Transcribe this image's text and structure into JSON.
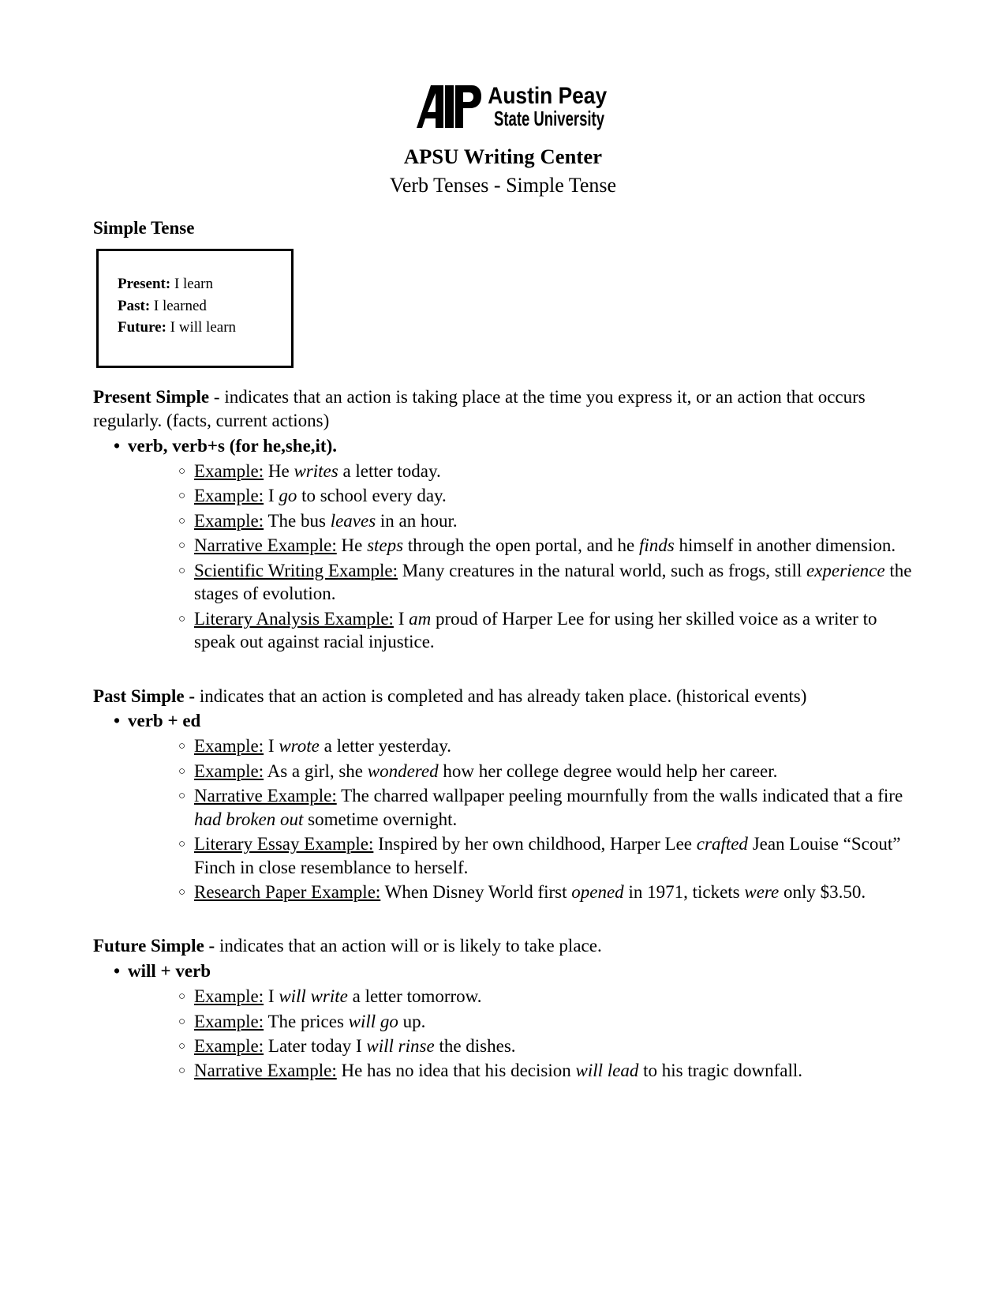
{
  "header": {
    "logo_alt": "Austin Peay State University",
    "logo_line1": "Austin Peay",
    "logo_line2": "State University",
    "org_title": "APSU Writing Center",
    "doc_subtitle": "Verb Tenses - Simple Tense"
  },
  "section_heading": "Simple Tense",
  "tense_box": {
    "rows": [
      {
        "label": "Present:",
        "text": " I learn"
      },
      {
        "label": "Past:",
        "text": " I learned"
      },
      {
        "label": "Future:",
        "text": " I will learn"
      }
    ]
  },
  "sections": [
    {
      "id": "present-simple",
      "title": "Present Simple",
      "description": " - indicates that an action is taking place at the time you express it, or an action that occurs regularly. (facts, current actions)",
      "form": "verb, verb+s (for he,she,it).",
      "examples": [
        {
          "label": "Example:",
          "pre": "  He ",
          "italic": "writes",
          "post": " a letter today."
        },
        {
          "label": "Example:",
          "pre": " I ",
          "italic": "go",
          "post": " to school every day."
        },
        {
          "label": "Example:",
          "pre": " The bus ",
          "italic": "leaves",
          "post": " in an hour."
        },
        {
          "label": "Narrative Example:",
          "pre": " He ",
          "italic": "steps",
          "post": " through the open portal, and he ",
          "italic2": "finds",
          "post2": " himself in another dimension."
        },
        {
          "label": "Scientific Writing Example:",
          "pre": " Many creatures in the natural world, such as frogs, still ",
          "italic": "experience",
          "post": " the stages of evolution."
        },
        {
          "label": "Literary Analysis Example:",
          "pre": " I ",
          "italic": "am",
          "post": " proud of Harper Lee for using her skilled voice as a writer to speak out against racial injustice."
        }
      ]
    },
    {
      "id": "past-simple",
      "title": "Past Simple -",
      "description": " indicates that an action is completed and has already taken place. (historical events)",
      "form": "verb + ed",
      "examples": [
        {
          "label": "Example:",
          "pre": " I ",
          "italic": "wrote",
          "post": " a letter yesterday."
        },
        {
          "label": "Example:",
          "pre": " As a girl, she ",
          "italic": "wondered",
          "post": " how her college degree would help her career."
        },
        {
          "label": "Narrative Example:",
          "pre": " The charred wallpaper peeling mournfully from the walls indicated that a fire ",
          "italic": "had broken out",
          "post": " sometime overnight."
        },
        {
          "label": "Literary Essay Example:",
          "pre": " Inspired by her own childhood, Harper Lee ",
          "italic": "crafted",
          "post": " Jean Louise “Scout” Finch in close resemblance to herself."
        },
        {
          "label": "Research Paper Example:",
          "pre": " When Disney World first ",
          "italic": "opened",
          "post": " in 1971, tickets ",
          "italic2": "were",
          "post2": " only $3.50."
        }
      ]
    },
    {
      "id": "future-simple",
      "title": "Future Simple -",
      "description": " indicates that an action will or is likely to take place.",
      "form": "will + verb",
      "examples": [
        {
          "label": "Example:",
          "pre": " I ",
          "italic": "will write",
          "post": " a letter tomorrow."
        },
        {
          "label": "Example:",
          "pre": " The prices ",
          "italic": "will go",
          "post": " up."
        },
        {
          "label": "Example:",
          "pre": " Later today I ",
          "italic": "will rinse",
          "post": " the dishes."
        },
        {
          "label": "Narrative Example:",
          "pre": " He has no idea that his decision ",
          "italic": "will lead",
          "post": " to his tragic downfall."
        }
      ]
    }
  ],
  "markers": {
    "bullet_level1": "•",
    "bullet_level2": "○"
  },
  "colors": {
    "text": "#000000",
    "background": "#ffffff",
    "box_border": "#000000"
  }
}
